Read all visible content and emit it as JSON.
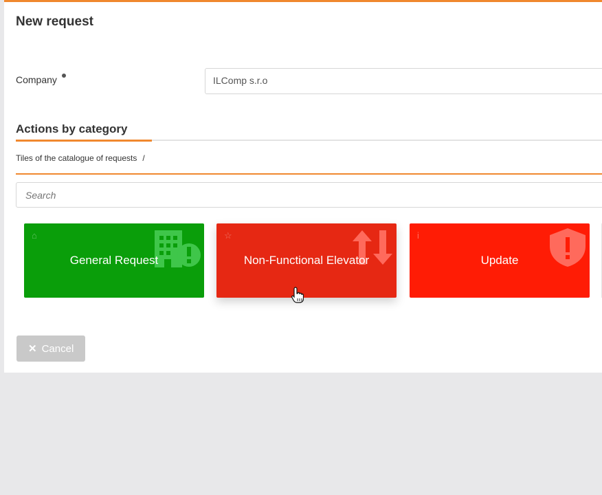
{
  "page": {
    "title": "New request"
  },
  "company": {
    "label": "Company",
    "value": "ILComp s.r.o"
  },
  "section": {
    "title": "Actions by category"
  },
  "breadcrumb": {
    "text": "Tiles of the catalogue of requests",
    "separator": "/"
  },
  "search": {
    "placeholder": "Search"
  },
  "tiles": [
    {
      "label": "General Request",
      "color": "#0a9e0a",
      "icon": "building-alert-icon"
    },
    {
      "label": "Non-Functional Elevator",
      "color": "#e62813",
      "icon": "up-down-arrows-icon"
    },
    {
      "label": "Update",
      "color": "#ff1c05",
      "icon": "shield-alert-icon"
    }
  ],
  "actions": {
    "cancel_label": "Cancel"
  },
  "colors": {
    "accent": "#f0882e",
    "background": "#e8e8ea"
  }
}
